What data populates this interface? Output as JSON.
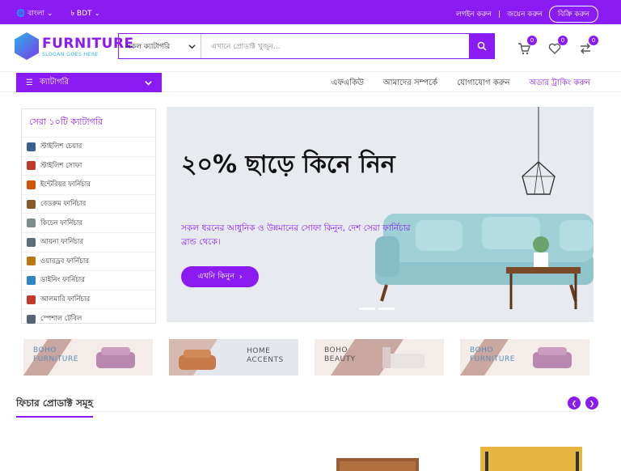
{
  "topbar": {
    "language": "বাংলা",
    "currency": "৳ BDT",
    "login": "লগইন করুন",
    "separator": "|",
    "register": "জয়েন করুন",
    "seller_button": "বিক্রি করুন"
  },
  "logo": {
    "name": "FURNITURE",
    "slogan": "SLOGAN GOES HERE"
  },
  "search": {
    "category_select": "সকল ক্যাটাগরি",
    "placeholder": "এখানে প্রোডাক্ট খুজুন..."
  },
  "header_icons": {
    "cart_count": "0",
    "wishlist_count": "0",
    "compare_count": "0"
  },
  "nav": {
    "category_button": "ক্যাটাগরি",
    "links": [
      "এফএকিউ",
      "আমাদের সম্পর্কে",
      "যোগাযোগ করুন",
      "অডার ট্রাকিং করুন"
    ]
  },
  "sidebar": {
    "title": "সেরা ১০টি ক্যাটাগরি",
    "items": [
      "স্টাইলিশ চেয়ার",
      "স্টাইলিশ সোফা",
      "ইন্টেরিয়র ফার্নিচার",
      "বেডরুম ফার্নিচার",
      "কিচেন ফার্নিচার",
      "আয়না ফার্নিচার",
      "ওয়ারড্রব ফার্নিচার",
      "ডাইনিং ফার্নিচার",
      "আলমারি ফার্নিচার",
      "স্পেশাল টেবিল"
    ]
  },
  "hero": {
    "heading": "২০% ছাড়ে কিনে নিন",
    "text": "সকল ধরনের আধুনিক ও উন্নমানের সোফা কিনুন, দেশ সেরা ফার্নিচার ব্রান্ড থেকে।",
    "button": "এখনি কিনুন"
  },
  "banners": [
    {
      "line1": "BOHO",
      "line2": "FURNITURE"
    },
    {
      "line1": "HOME",
      "line2": "ACCENTS"
    },
    {
      "line1": "BOHO",
      "line2": "BEAUTY"
    },
    {
      "line1": "BOHO",
      "line2": "FURNITURE"
    }
  ],
  "section": {
    "title": "ফিচার প্রোডাক্ট সমূহ"
  }
}
